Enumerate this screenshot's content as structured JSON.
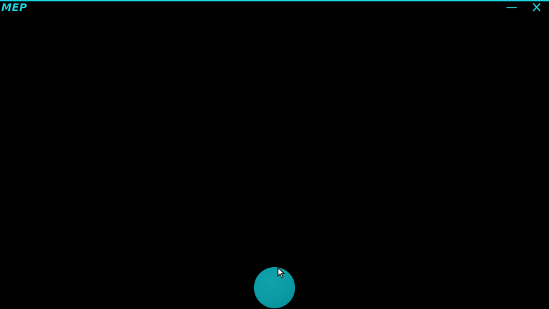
{
  "window": {
    "title": "MEP",
    "accent_color": "#19d3df",
    "background_color": "#000000"
  },
  "titlebar": {
    "minimize_icon": "minimize-icon",
    "close_icon": "close-icon"
  },
  "main": {
    "orb_color": "#0a9aa3",
    "cursor_icon": "mouse-pointer-icon"
  }
}
